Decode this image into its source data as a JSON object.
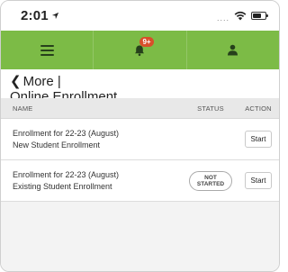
{
  "status_bar": {
    "time": "2:01",
    "signal": "....",
    "icons": [
      "location-arrow-icon",
      "wifi-icon",
      "battery-icon"
    ]
  },
  "nav": {
    "icons": [
      "menu-icon",
      "bell-icon",
      "user-icon"
    ],
    "notification_badge": "9+",
    "colors": {
      "nav_bg": "#7cbb46",
      "badge_bg": "#d84f2a"
    }
  },
  "header": {
    "back_label": "More |",
    "title": "Online Enrollment"
  },
  "table": {
    "columns": {
      "name": "NAME",
      "status": "STATUS",
      "action": "ACTION"
    },
    "rows": [
      {
        "name_line1": "Enrollment for 22-23 (August)",
        "name_line2": "New Student Enrollment",
        "status_line1": "",
        "status_line2": "",
        "action": "Start"
      },
      {
        "name_line1": "Enrollment for 22-23 (August)",
        "name_line2": "Existing Student Enrollment",
        "status_line1": "NOT",
        "status_line2": "STARTED",
        "action": "Start"
      }
    ]
  }
}
